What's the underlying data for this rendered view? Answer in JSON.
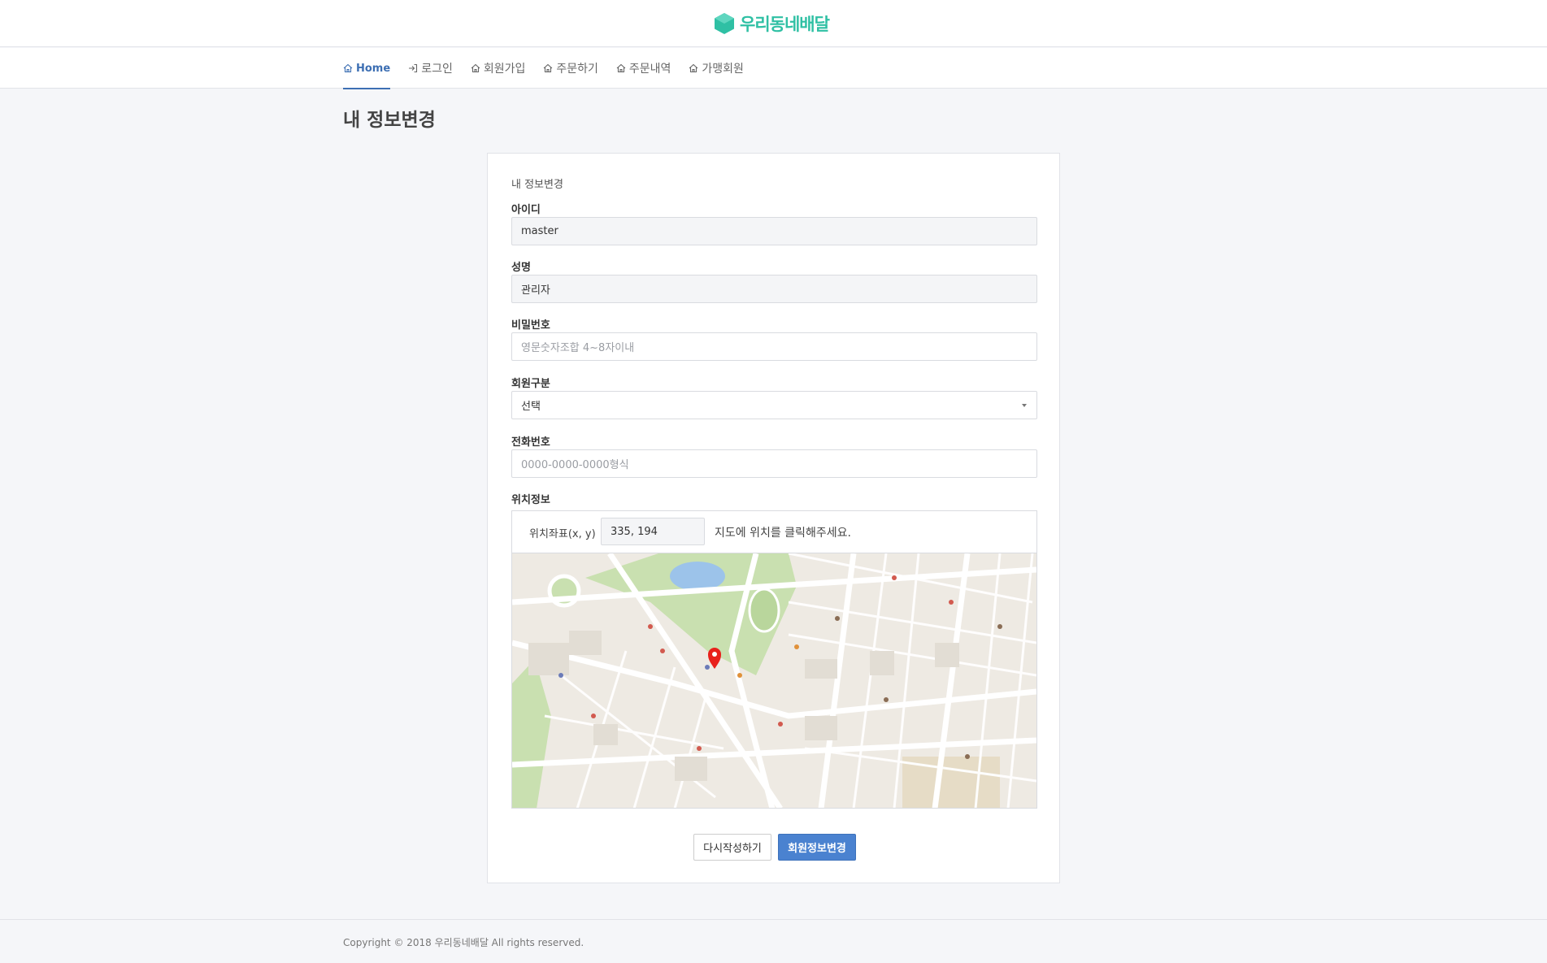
{
  "brand": {
    "name": "우리동네배달",
    "color": "#2fc0a4",
    "logo_icon": "hexagon-icon"
  },
  "nav": {
    "items": [
      {
        "label": "Home",
        "icon": "home-icon",
        "active": true
      },
      {
        "label": "로그인",
        "icon": "login-icon",
        "active": false
      },
      {
        "label": "회원가입",
        "icon": "home-icon",
        "active": false
      },
      {
        "label": "주문하기",
        "icon": "home-icon",
        "active": false
      },
      {
        "label": "주문내역",
        "icon": "home-icon",
        "active": false
      },
      {
        "label": "가맹회원",
        "icon": "home-icon",
        "active": false
      }
    ],
    "accent": "#3d6fb3"
  },
  "page": {
    "title": "내 정보변경"
  },
  "form": {
    "caption": "내 정보변경",
    "id": {
      "label": "아이디",
      "value": "master"
    },
    "name": {
      "label": "성명",
      "value": "관리자"
    },
    "password": {
      "label": "비밀번호",
      "placeholder": "영문숫자조합 4~8자이내"
    },
    "member_type": {
      "label": "회원구분",
      "selected": "선택"
    },
    "phone": {
      "label": "전화번호",
      "placeholder": "0000-0000-0000형식"
    },
    "location": {
      "label": "위치정보",
      "coord_label": "위치좌표(x, y)",
      "coord_value": "335, 194",
      "hint": "지도에 위치를 클릭해주세요."
    },
    "buttons": {
      "reset": "다시작성하기",
      "submit": "회원정보변경"
    },
    "submit_color": "#4a82d0"
  },
  "footer": {
    "text": "Copyright © 2018 우리동네배달 All rights reserved."
  }
}
